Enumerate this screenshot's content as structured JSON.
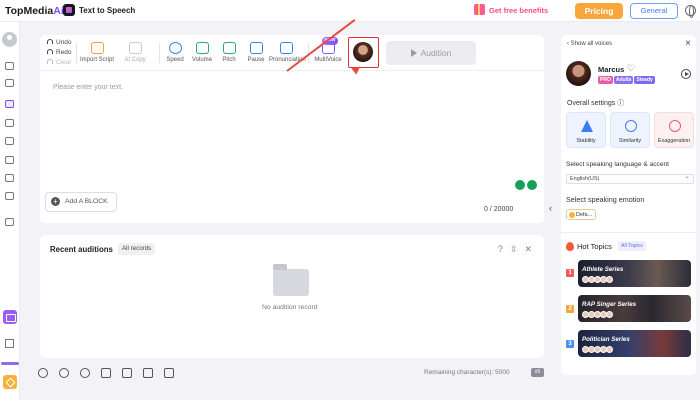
{
  "header": {
    "logo_text": "TopMedia",
    "logo_suffix": "Ai",
    "app_title": "Text to Speech",
    "free_benefits": "Get free benefits",
    "pricing": "Pricing",
    "general": "General"
  },
  "toolbar": {
    "undo": "Undo",
    "redo": "Redo",
    "clear": "Clear",
    "import_script": "Import Script",
    "ai_copy": "AI Copy",
    "speed": "Speed",
    "volume": "Volume",
    "pitch": "Pitch",
    "pause": "Pause",
    "pronunciation": "Pronunciation",
    "multivoice": "MultiVoice",
    "new_badge": "NEW",
    "audition": "Audition"
  },
  "editor": {
    "placeholder": "Please enter your text.",
    "add_block": "Add A BLOCK",
    "char_count": "0",
    "char_sep": "/",
    "char_limit": "20000"
  },
  "recent": {
    "title": "Recent auditions",
    "all_records": "All records",
    "empty_text": "No audition record"
  },
  "footer": {
    "remaining": "Remaining character(s): 5000",
    "badge": "x5"
  },
  "voices": {
    "show_all": "Show all voices",
    "name": "Marcus",
    "tags": [
      "PRO",
      "Adults",
      "Steady"
    ],
    "overall_settings": "Overall settings",
    "cards": [
      {
        "label": "Stability"
      },
      {
        "label": "Similarity"
      },
      {
        "label": "Exaggeration"
      }
    ],
    "language_label": "Select speaking language & accent",
    "language_value": "English(US)",
    "emotion_label": "Select speaking emotion",
    "emotion_value": "Defa...",
    "hot_topics": "Hot Topics",
    "all_topics": "All Topics",
    "topics": [
      {
        "rank": "1",
        "name": "Athlete Series"
      },
      {
        "rank": "2",
        "name": "RAP Singer Series"
      },
      {
        "rank": "3",
        "name": "Politician Series"
      }
    ]
  },
  "colors": {
    "accent": "#7b4dff",
    "pricing": "#f7a73a",
    "highlight_box": "#e0312e",
    "annotation_arrow": "#e64a3c",
    "link_blue": "#3b7bff"
  },
  "icons": {
    "header": [
      "app-badge-icon",
      "gift-icon",
      "globe-icon"
    ],
    "sidebar": [
      "user-avatar-icon",
      "cube-icon",
      "folder-icon",
      "voice-icon",
      "music-icon",
      "copy-icon",
      "mic-icon",
      "pen-icon",
      "swap-icon",
      "store-icon",
      "calendar-icon",
      "grid-icon",
      "diamond-icon"
    ],
    "footer": [
      "person-voice-icon",
      "heart-icon",
      "history-icon",
      "thumb-up-icon",
      "thumbs-icon",
      "image-icon",
      "letter-a-icon"
    ]
  }
}
